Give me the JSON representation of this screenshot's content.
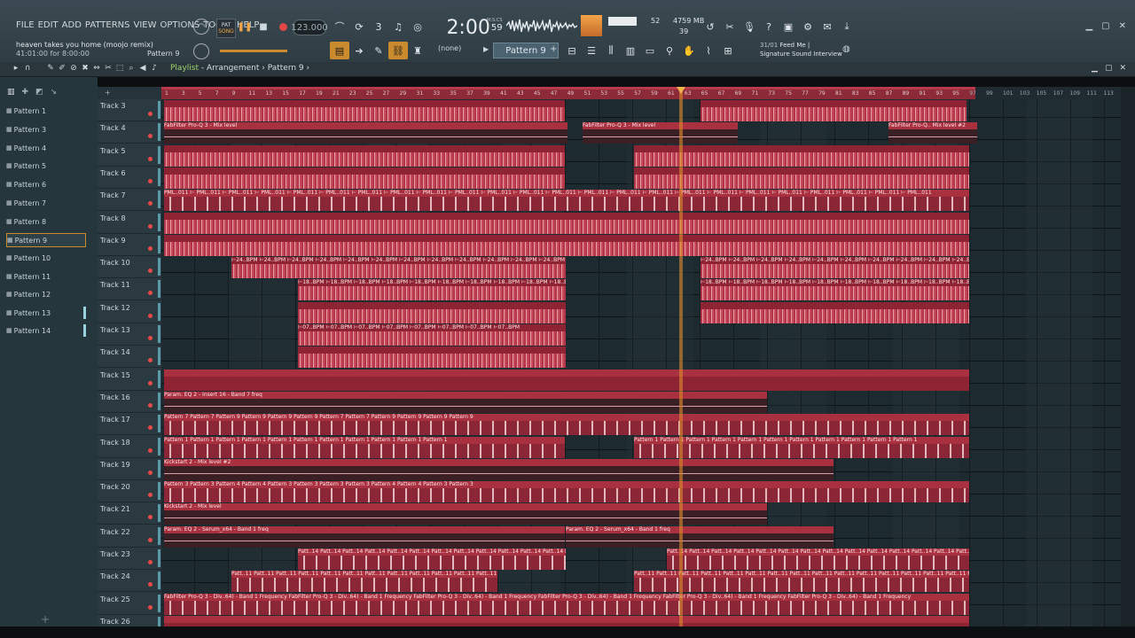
{
  "menu": [
    "FILE",
    "EDIT",
    "ADD",
    "PATTERNS",
    "VIEW",
    "OPTIONS",
    "TOOLS",
    "HELP"
  ],
  "song_info": {
    "title": "heaven takes you home (moojo remix)",
    "position": "41:01:00 for 8:00:00"
  },
  "pattern_selector": "Pattern 9",
  "transport": {
    "mode_pat": "PAT",
    "mode_song": "SONG",
    "tempo": "123.000",
    "time": "2:00",
    "time_small": "59",
    "time_label": "M:S:CS"
  },
  "monitor": {
    "cpu": "52",
    "ram": "4759 MB",
    "poly": "39"
  },
  "snap": "(none)",
  "current_pattern": "Pattern 9",
  "hint": {
    "num": "31/01",
    "line1": "Feed Me |",
    "line2": "Signature Sound Interview"
  },
  "playlist_title": {
    "prefix": "Playlist",
    "rest": " - Arrangement › Pattern 9 ›"
  },
  "picker_items": [
    "Pattern 1",
    "Pattern 3",
    "Pattern 4",
    "Pattern 5",
    "Pattern 6",
    "Pattern 7",
    "Pattern 8",
    "Pattern 9",
    "Pattern 10",
    "Pattern 11",
    "Pattern 12",
    "Pattern 13",
    "Pattern 14"
  ],
  "tracks": [
    "Track 3",
    "Track 4",
    "Track 5",
    "Track 6",
    "Track 7",
    "Track 8",
    "Track 9",
    "Track 10",
    "Track 11",
    "Track 12",
    "Track 13",
    "Track 14",
    "Track 15",
    "Track 16",
    "Track 17",
    "Track 18",
    "Track 19",
    "Track 20",
    "Track 21",
    "Track 22",
    "Track 23",
    "Track 24",
    "Track 25",
    "Track 26"
  ],
  "ruler_ticks": [
    "1",
    "3",
    "5",
    "7",
    "9",
    "11",
    "13",
    "15",
    "17",
    "19",
    "21",
    "23",
    "25",
    "27",
    "29",
    "31",
    "33",
    "35",
    "37",
    "39",
    "41",
    "43",
    "45",
    "47",
    "49",
    "51",
    "53",
    "55",
    "57",
    "59",
    "61",
    "63",
    "65",
    "67",
    "69",
    "71",
    "73",
    "75",
    "77",
    "79",
    "81",
    "83",
    "85",
    "87",
    "89",
    "91",
    "93",
    "95",
    "97",
    "99",
    "101",
    "103",
    "105",
    "107",
    "109",
    "111",
    "113"
  ],
  "clip_labels": {
    "t4a": "FabFilter Pro-Q 3 - Mix level",
    "t4b": "FabFilter Pro-Q 3 - Mix level",
    "t4c": "FabFilter Pro-Q.. Mix level #2",
    "t7": "PML..011 ⊢ PML..011 ⊢ PML..011 ⊢ PML..011 ⊢ PML..011 ⊢ PML..011 ⊢ PML..011 ⊢ PML..011 ⊢ PML..011 ⊢ PML..011 ⊢ PML..011 ⊢ PML..011 ⊢ PML..011 ⊢ PML..011 ⊢ PML..011 ⊢ PML..011 ⊢ PML..011 ⊢ PML..011 ⊢ PML..011 ⊢ PML..011 ⊢ PML..011 ⊢ PML..011 ⊢ PML..011 ⊢ PML..011",
    "t10": "⊢24..BPM ⊢24..BPM ⊢24..BPM ⊢24..BPM ⊢24..BPM ⊢24..BPM ⊢24..BPM ⊢24..BPM ⊢24..BPM ⊢24..BPM ⊢24..BPM ⊢24..BPM ⊢24..BPM ⊢24..BPM ⊢24..BPM ⊢24..BPM ⊢24..BPM ⊢24..BPM",
    "t11": "⊢18..BPM ⊢18..BPM ⊢18..BPM ⊢18..BPM ⊢18..BPM ⊢18..BPM ⊢18..BPM ⊢18..BPM ⊢18..BPM ⊢18..BPM ⊢18..BPM ⊢18..BPM ⊢18..BPM ⊢18..BPM ⊢18..BPM ⊢18..BPM ⊢18..BPM ⊢18..BPM",
    "t13": "⊢07..BPM ⊢07..BPM ⊢07..BPM ⊢07..BPM ⊢07..BPM ⊢07..BPM ⊢07..BPM ⊢07..BPM",
    "t16": "Param. EQ 2 - Insert 16 - Band 7 freq",
    "t17": "Pattern 7   Pattern 7   Pattern 9   Pattern 9   Pattern 9   Pattern 9   Pattern 7   Pattern 7   Pattern 9   Pattern 9   Pattern 9   Pattern 9",
    "t18": "Pattern 1   Pattern 1   Pattern 1   Pattern 1   Pattern 1   Pattern 1   Pattern 1   Pattern 1   Pattern 1   Pattern 1   Pattern 1",
    "t19": "Kickstart 2 - Mix level #2",
    "t20": "Pattern 3   Pattern 3   Pattern 4   Pattern 4   Pattern 3   Pattern 3   Pattern 3   Pattern 3   Pattern 4   Pattern 4   Pattern 3   Pattern 3",
    "t21": "Kickstart 2 - Mix level",
    "t22a": "Param. EQ 2 - Serum_x64 - Band 1 freq",
    "t22b": "Param. EQ 2 - Serum_x64 - Band 1 freq",
    "t23": "Patt..14  Patt..14  Patt..14  Patt..14  Patt..14  Patt..14  Patt..14  Patt..14  Patt..14  Patt..14  Patt..14  Patt..14  Patt..14  Patt..14  Patt..14  Patt..14  Patt..14  Patt..14",
    "t24": "Patt..11  Patt..11  Patt..11  Patt..11  Patt..11  Patt..11  Patt..11  Patt..11  Patt..11  Patt..11  Patt..11  Patt..11  Patt..11  Patt..11  Patt..11  Patt..11",
    "t25": "FabFilter Pro-Q 3 - Div..64) - Band 1 Frequency  FabFilter Pro-Q 3 - Div..64) - Band 1 Frequency  FabFilter Pro-Q 3 - Div..64) - Band 1 Frequency  FabFilter Pro-Q 3 - Div..64) - Band 1 Frequency  FabFilter Pro-Q 3 - Div..64) - Band 1 Frequency  FabFilter Pro-Q 3 - Div..64) - Band 1 Frequency"
  },
  "colors": {
    "clip": "#b23647",
    "clip_header": "#8e2333",
    "playhead": "#de8c30",
    "grid": "#1d2a30"
  }
}
